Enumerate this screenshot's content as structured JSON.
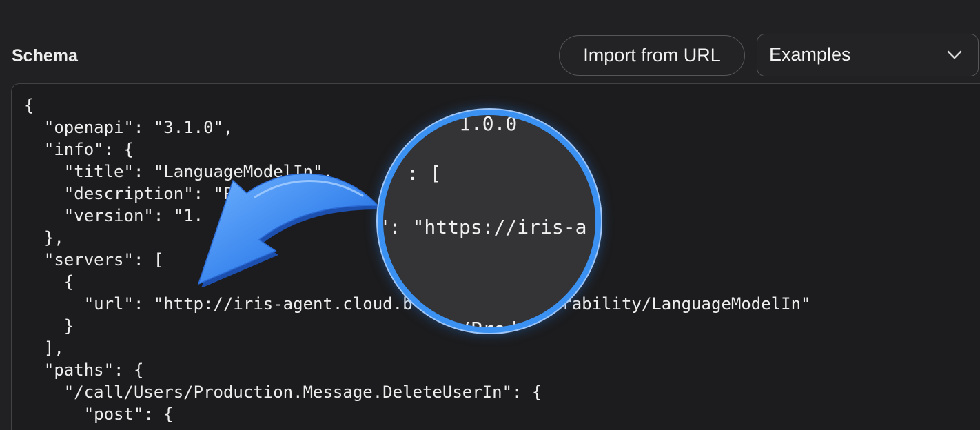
{
  "header": {
    "title": "Schema",
    "import_button_label": "Import from URL",
    "examples_label": "Examples"
  },
  "editor": {
    "lines": [
      "{",
      "  \"openapi\": \"3.1.0\",",
      "  \"info\": {",
      "    \"title\": \"LanguageModelIn\",",
      "    \"description\": \"P      iris Ag",
      "    \"version\": \"1.",
      "  },",
      "  \"servers\": [",
      "    {",
      "      \"url\": \"http://iris-agent.cloud.b      /interoperability/LanguageModelIn\"",
      "    }",
      "  ],",
      "  \"paths\": {",
      "    \"/call/Users/Production.Message.DeleteUserIn\": {",
      "      \"post\": {"
    ]
  },
  "magnifier": {
    "line1": "1.0.0",
    "line2": ": [",
    "line3": "\": \"https://iris-a",
    "line4": "/Prod"
  },
  "colors": {
    "background": "#212123",
    "editor_background": "#1c1c1e",
    "magnifier_ring": "#3b91f1",
    "arrow": "#3f8ef0"
  },
  "icons": {
    "examples_dropdown": "chevron-down-icon",
    "annotation": "curved-arrow-icon"
  }
}
